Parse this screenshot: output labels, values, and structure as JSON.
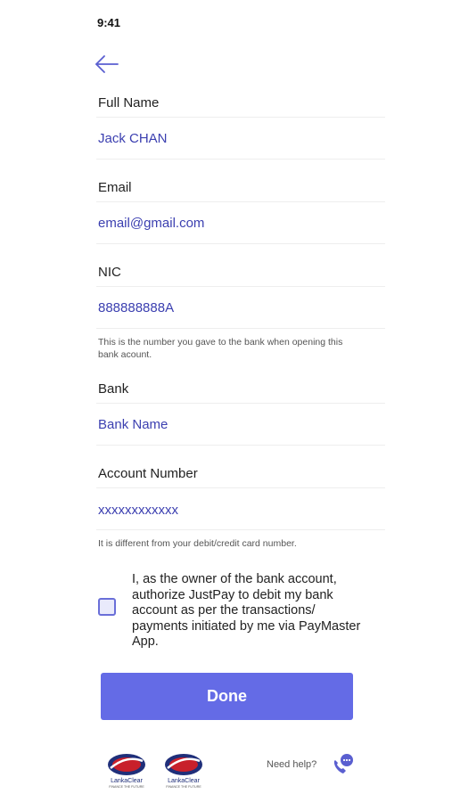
{
  "status_bar": {
    "time": "9:41"
  },
  "nav": {
    "back_icon": "arrow-left-icon"
  },
  "fields": [
    {
      "label": "Full Name",
      "value": "Jack CHAN"
    },
    {
      "label": "Email",
      "value": "email@gmail.com"
    },
    {
      "label": "NIC",
      "value": "888888888A"
    },
    {
      "label": "Bank",
      "value": "Bank Name"
    },
    {
      "label": "Account Number",
      "value": "xxxxxxxxxxxx"
    }
  ],
  "helpers": {
    "nic": "This is the number you gave to the bank when opening this bank acount.",
    "account": "It is different from your debit/credit card number."
  },
  "consent": {
    "text": "I, as the owner of the bank account, authorize JustPay to debit my bank account as per the transactions/ payments initiated by me via PayMaster App.",
    "checked": false
  },
  "actions": {
    "done_label": "Done"
  },
  "footer": {
    "logos": [
      {
        "name": "LankaClear",
        "tagline": "FINANCE THE FUTURE"
      },
      {
        "name": "LankaClear",
        "tagline": "FINANCE THE FUTURE"
      }
    ],
    "help_label": "Need help?",
    "help_icon": "phone-chat-icon"
  },
  "colors": {
    "accent": "#646be6",
    "value_text": "#3b3fb0",
    "logo_red": "#c8202b",
    "logo_navy": "#1f2f7a"
  }
}
